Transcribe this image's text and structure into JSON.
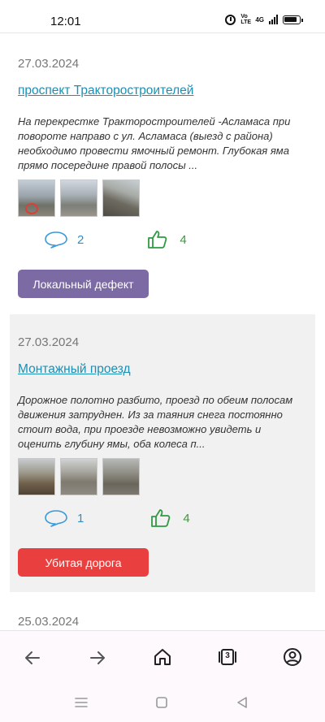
{
  "status_bar": {
    "time": "12:01",
    "volte": "Vo LTE",
    "network": "4G"
  },
  "reports": [
    {
      "date": "27.03.2024",
      "street": "проспект Тракторостроителей",
      "description": "На перекрестке Тракторостроителей -Асламаса при повороте направо с ул. Асламаса (выезд с района) необходимо провести ямочный ремонт. Глубокая яма прямо посередине правой полосы ...",
      "comments": "2",
      "likes": "4",
      "category": "Локальный дефект",
      "category_color": "#7b6aa4"
    },
    {
      "date": "27.03.2024",
      "street": "Монтажный проезд",
      "description": "Дорожное полотно разбито, проезд по обеим полосам движения затруднен. Из за таяния снега постоянно стоит вода, при проезде невозможно увидеть и оценить глубину ямы, оба колеса п...",
      "comments": "1",
      "likes": "4",
      "category": "Убитая дорога",
      "category_color": "#e9403f"
    },
    {
      "date": "25.03.2024"
    }
  ],
  "browser_bar": {
    "tab_count": "3",
    "icons": [
      "back-arrow-icon",
      "forward-arrow-icon",
      "home-icon",
      "tabs-icon",
      "account-icon"
    ]
  },
  "system_nav": {
    "icons": [
      "recents-icon",
      "home-square-icon",
      "back-triangle-icon"
    ]
  }
}
